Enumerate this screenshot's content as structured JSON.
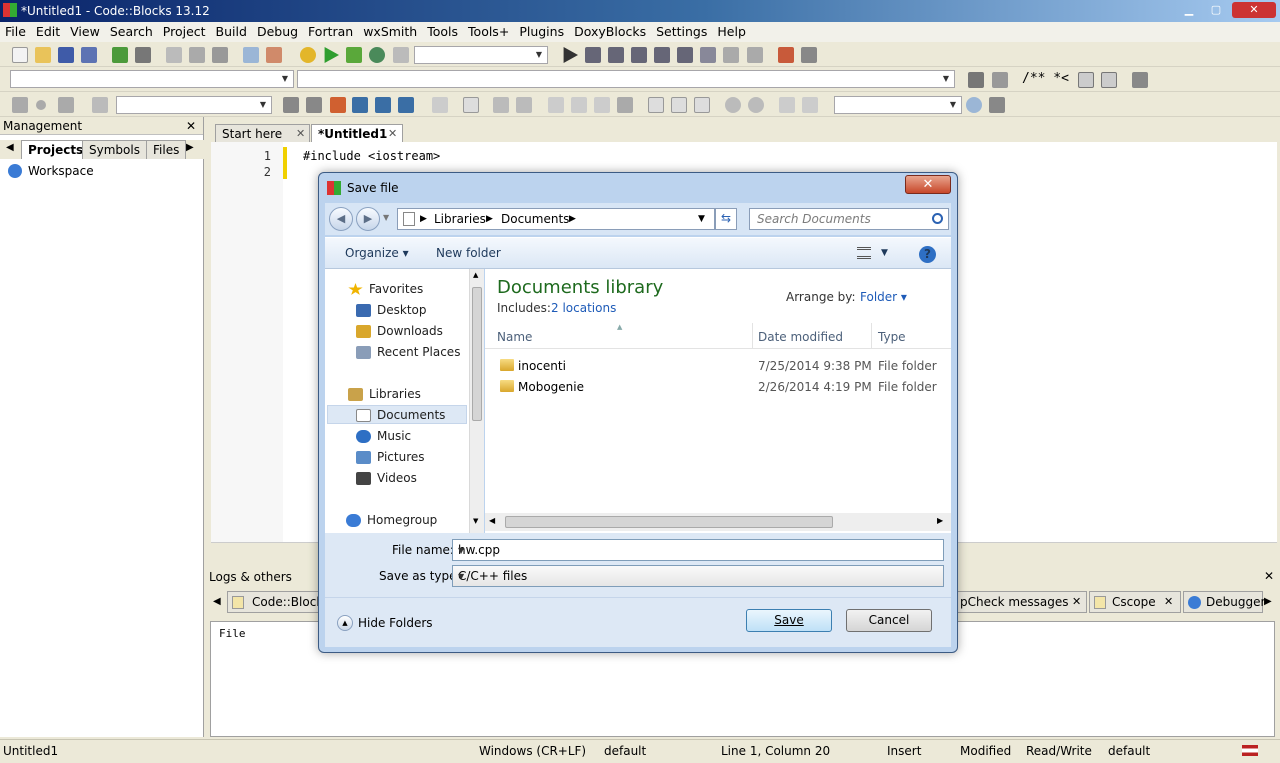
{
  "window": {
    "title": "*Untitled1 - Code::Blocks 13.12",
    "min": "▁",
    "max": "▢",
    "close": "✕"
  },
  "menu": [
    "File",
    "Edit",
    "View",
    "Search",
    "Project",
    "Build",
    "Debug",
    "Fortran",
    "wxSmith",
    "Tools",
    "Tools+",
    "Plugins",
    "DoxyBlocks",
    "Settings",
    "Help"
  ],
  "toolbar3": {
    "doxy_comment": "/** *<"
  },
  "management": {
    "title": "Management",
    "close": "✕",
    "tabs": [
      "Projects",
      "Symbols",
      "Files"
    ],
    "workspace": "Workspace"
  },
  "editor": {
    "tabs": [
      {
        "label": "Start here",
        "close": "✕"
      },
      {
        "label": "*Untitled1",
        "close": "✕"
      }
    ],
    "lines": [
      {
        "num": "1",
        "code": "#include <iostream>"
      },
      {
        "num": "2",
        "code": ""
      }
    ]
  },
  "logs": {
    "title": "Logs & others",
    "close": "✕",
    "tabs": [
      "Code::Blocks",
      "pCheck messages",
      "Cscope",
      "Debugger"
    ],
    "column": "File"
  },
  "status": {
    "file": "Untitled1",
    "eol": "Windows (CR+LF)",
    "encoding": "default",
    "position": "Line 1, Column 20",
    "mode": "Insert",
    "modified": "Modified",
    "access": "Read/Write",
    "lang": "default"
  },
  "dialog": {
    "title": "Save file",
    "close": "✕",
    "breadcrumb": [
      "Libraries",
      "Documents"
    ],
    "search_placeholder": "Search Documents",
    "organize": "Organize ▾",
    "new_folder": "New folder",
    "help": "?",
    "nav": {
      "favorites": "Favorites",
      "desktop": "Desktop",
      "downloads": "Downloads",
      "recent": "Recent Places",
      "libraries": "Libraries",
      "documents": "Documents",
      "music": "Music",
      "pictures": "Pictures",
      "videos": "Videos",
      "homegroup": "Homegroup"
    },
    "library_title": "Documents library",
    "includes_label": "Includes:",
    "includes_link": "2 locations",
    "arrange_label": "Arrange by:",
    "arrange_value": "Folder ▾",
    "columns": [
      "Name",
      "Date modified",
      "Type"
    ],
    "files": [
      {
        "name": "inocenti",
        "date": "7/25/2014 9:38 PM",
        "type": "File folder"
      },
      {
        "name": "Mobogenie",
        "date": "2/26/2014 4:19 PM",
        "type": "File folder"
      }
    ],
    "filename_label": "File name:",
    "filename_value": "hw.cpp",
    "savetype_label": "Save as type:",
    "savetype_value": "C/C++ files",
    "hide_folders": "Hide Folders",
    "save": "Save",
    "cancel": "Cancel"
  }
}
